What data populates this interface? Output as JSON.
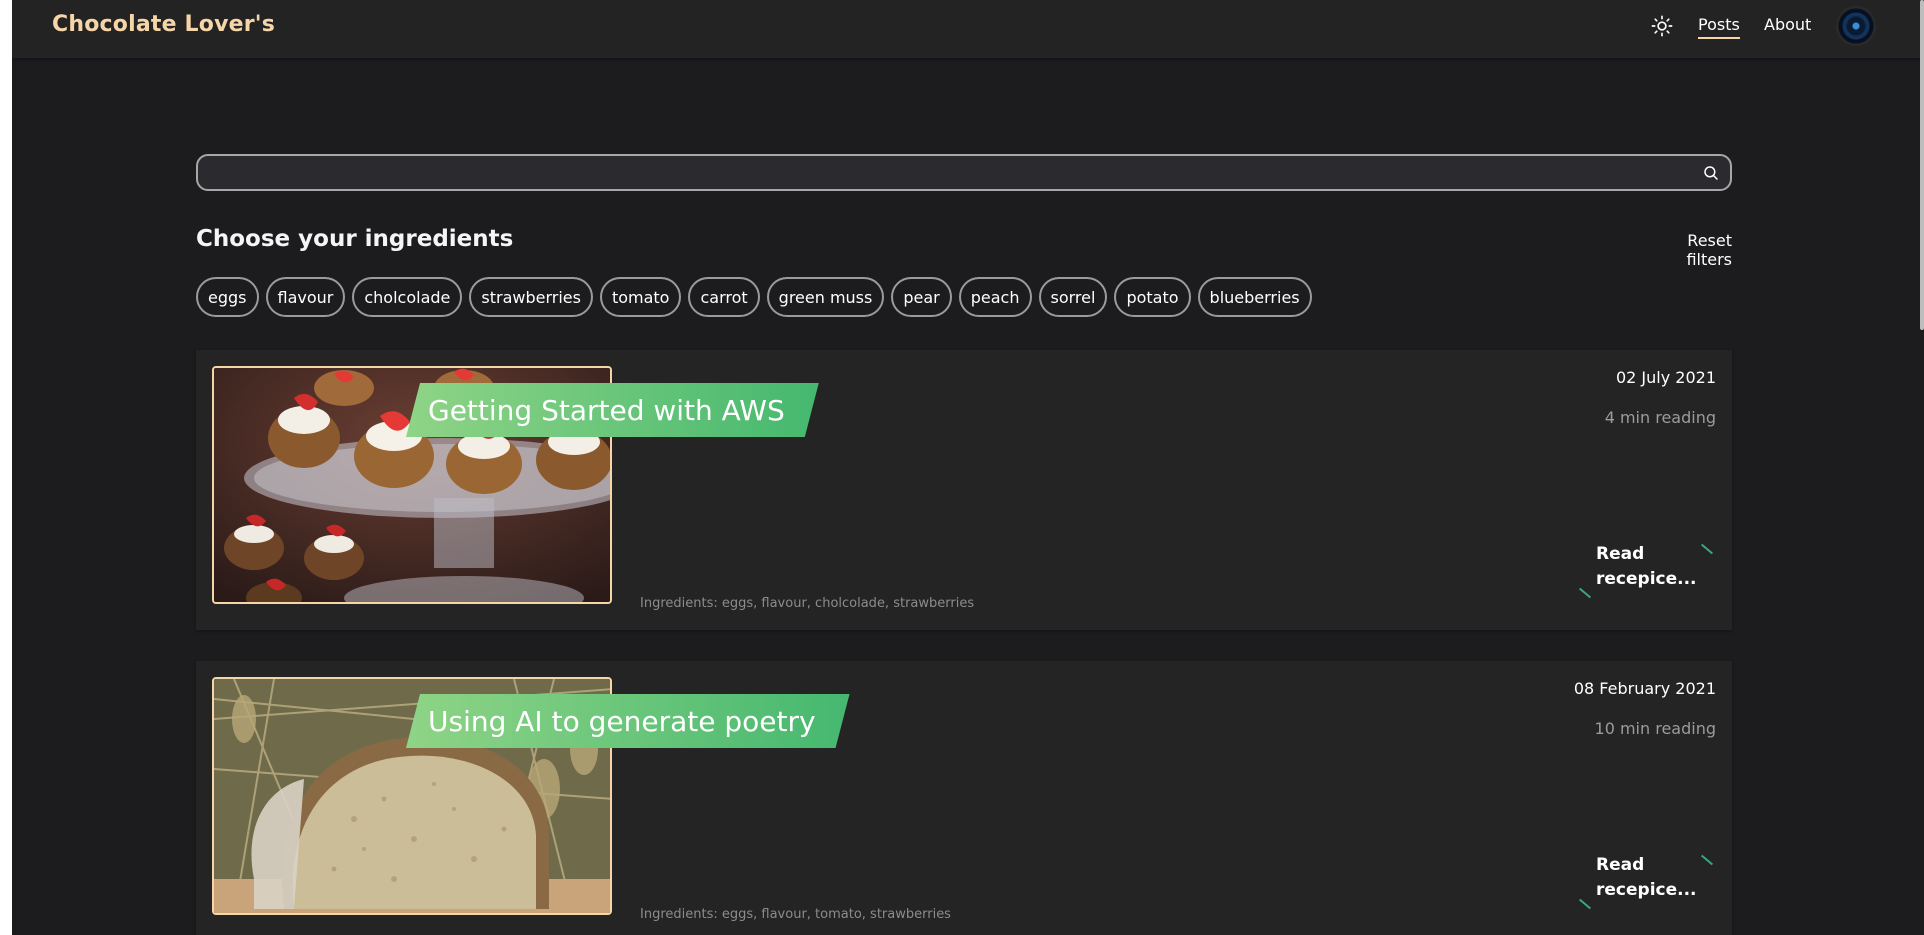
{
  "header": {
    "brand": "Chocolate Lover's",
    "nav": [
      {
        "label": "Posts",
        "active": true
      },
      {
        "label": "About",
        "active": false
      }
    ],
    "theme_icon": "sun-icon",
    "avatar_icon": "avatar"
  },
  "search": {
    "placeholder": "",
    "value": "",
    "icon": "search-icon"
  },
  "filters": {
    "title": "Choose your ingredients",
    "reset_label": "Reset filters",
    "chips": [
      "eggs",
      "flavour",
      "cholcolade",
      "strawberries",
      "tomato",
      "carrot",
      "green muss",
      "pear",
      "peach",
      "sorrel",
      "potato",
      "blueberries"
    ]
  },
  "posts": [
    {
      "title": "Getting Started with AWS",
      "date": "02 July 2021",
      "reading": "4 min reading",
      "ingredients": "Ingredients: eggs, flavour, cholcolade, strawberries",
      "read_more": "Read recepice...",
      "image": "strawberry-cupcakes-image"
    },
    {
      "title": "Using AI to generate poetry",
      "date": "08 February 2021",
      "reading": "10 min reading",
      "ingredients": "Ingredients: eggs, flavour, tomato, strawberries",
      "read_more": "Read recepice...",
      "image": "bread-loaf-image"
    }
  ],
  "colors": {
    "background": "#1c1c1f",
    "header": "#232323",
    "card": "#242424",
    "brand": "#f6d6a8",
    "banner_start": "#8fd486",
    "banner_end": "#45b86f",
    "accent_line": "#3aa87a"
  }
}
